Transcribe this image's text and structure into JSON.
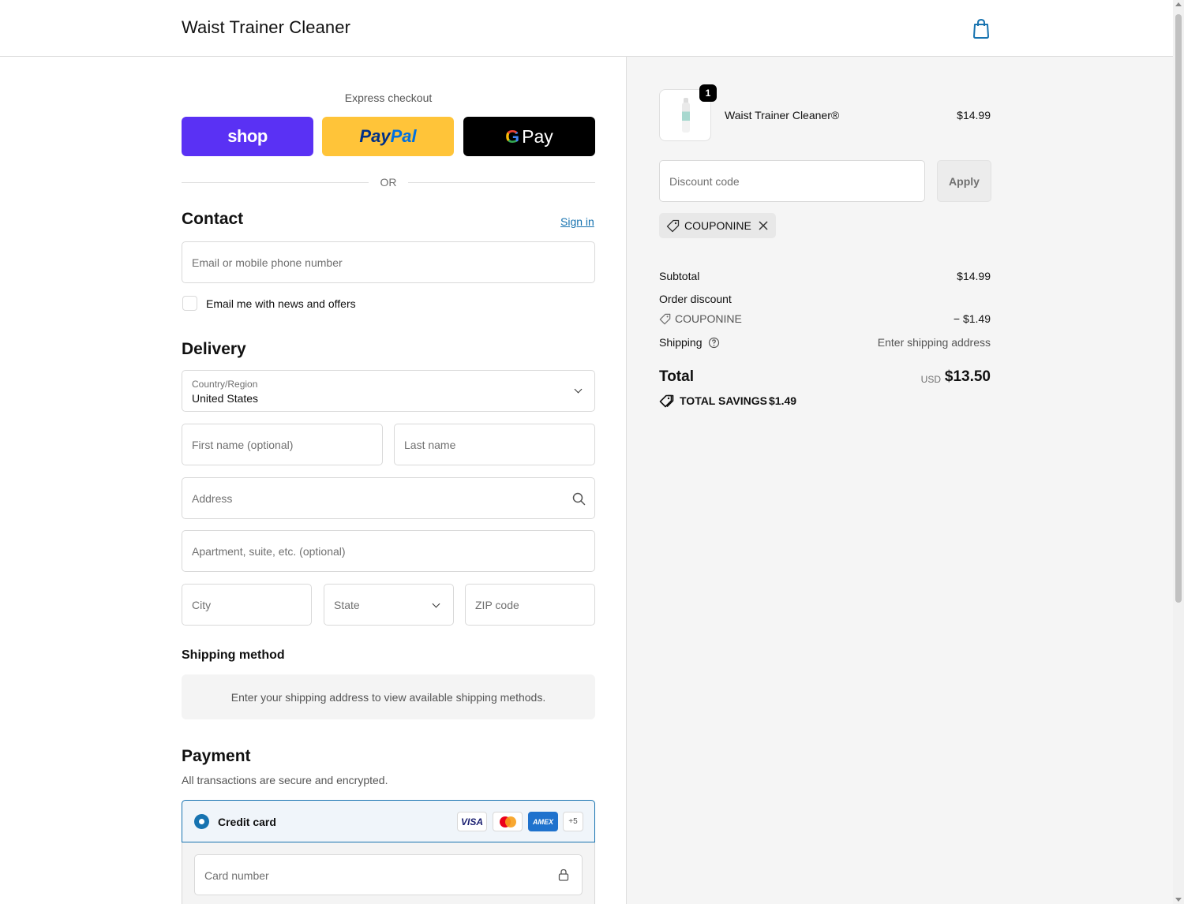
{
  "header": {
    "brand": "Waist Trainer Cleaner",
    "cart_icon": "shopping-bag-icon"
  },
  "express": {
    "label": "Express checkout",
    "shop_label": "shop",
    "paypal_label_1": "Pay",
    "paypal_label_2": "Pal",
    "gpay_g": "G",
    "gpay_label": "Pay",
    "or_label": "OR"
  },
  "contact": {
    "title": "Contact",
    "sign_in": "Sign in",
    "email_placeholder": "Email or mobile phone number",
    "newsletter_label": "Email me with news and offers"
  },
  "delivery": {
    "title": "Delivery",
    "country_label": "Country/Region",
    "country_value": "United States",
    "first_name_placeholder": "First name (optional)",
    "last_name_placeholder": "Last name",
    "address_placeholder": "Address",
    "apartment_placeholder": "Apartment, suite, etc. (optional)",
    "city_placeholder": "City",
    "state_placeholder": "State",
    "zip_placeholder": "ZIP code"
  },
  "shipping_method": {
    "title": "Shipping method",
    "message": "Enter your shipping address to view available shipping methods."
  },
  "payment": {
    "title": "Payment",
    "note": "All transactions are secure and encrypted.",
    "credit_card_label": "Credit card",
    "cards": {
      "visa": "VISA",
      "amex": "AMEX",
      "more": "+5"
    },
    "card_number_placeholder": "Card number"
  },
  "summary": {
    "item": {
      "name": "Waist Trainer Cleaner®",
      "price": "$14.99",
      "quantity": "1"
    },
    "discount_placeholder": "Discount code",
    "apply_label": "Apply",
    "coupon_code": "COUPONINE",
    "subtotal_label": "Subtotal",
    "subtotal_value": "$14.99",
    "order_discount_label": "Order discount",
    "discount_code": "COUPONINE",
    "discount_value": "− $1.49",
    "shipping_label": "Shipping",
    "shipping_value": "Enter shipping address",
    "total_label": "Total",
    "total_currency": "USD",
    "total_value": "$13.50",
    "savings_label": "TOTAL SAVINGS",
    "savings_value": "$1.49"
  },
  "colors": {
    "accent": "#1773b0",
    "shop": "#5a31f4",
    "paypal": "#ffc439",
    "gpay": "#000000",
    "summary_bg": "#f5f5f5"
  }
}
